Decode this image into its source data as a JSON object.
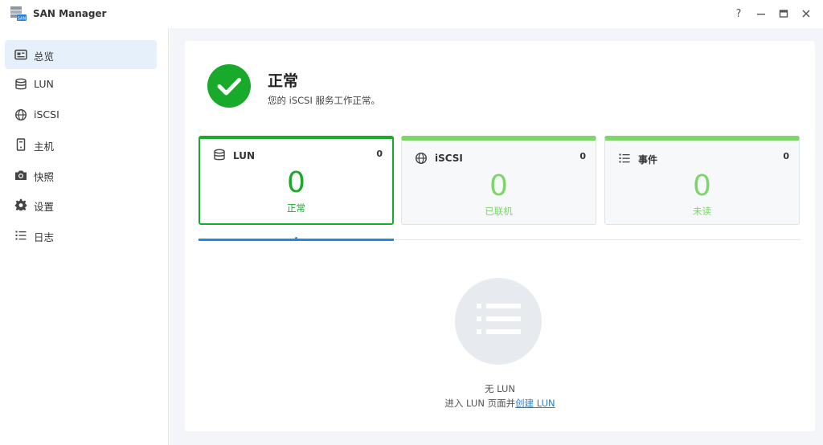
{
  "window": {
    "title": "SAN Manager",
    "help": "?",
    "minimize": "—",
    "maximize": "▣",
    "close": "✕"
  },
  "sidebar": {
    "items": [
      {
        "label": "总览",
        "icon": "overview-icon",
        "active": true
      },
      {
        "label": "LUN",
        "icon": "database-icon"
      },
      {
        "label": "iSCSI",
        "icon": "globe-icon"
      },
      {
        "label": "主机",
        "icon": "host-icon"
      },
      {
        "label": "快照",
        "icon": "camera-icon"
      },
      {
        "label": "设置",
        "icon": "gear-icon"
      },
      {
        "label": "日志",
        "icon": "list-icon"
      }
    ]
  },
  "status": {
    "title": "正常",
    "description": "您的 iSCSI 服务工作正常。"
  },
  "cards": [
    {
      "label": "LUN",
      "count": "0",
      "value": "0",
      "sub": "正常",
      "icon": "database-icon"
    },
    {
      "label": "iSCSI",
      "count": "0",
      "value": "0",
      "sub": "已联机",
      "icon": "globe-icon"
    },
    {
      "label": "事件",
      "count": "0",
      "value": "0",
      "sub": "未读",
      "icon": "list-icon"
    }
  ],
  "empty": {
    "title": "无 LUN",
    "prefix": "进入 LUN 页面并",
    "link": "创建 LUN"
  },
  "colors": {
    "accent_green": "#1aaa2b",
    "light_green": "#7fd46a",
    "link_blue": "#1f7ed0"
  }
}
